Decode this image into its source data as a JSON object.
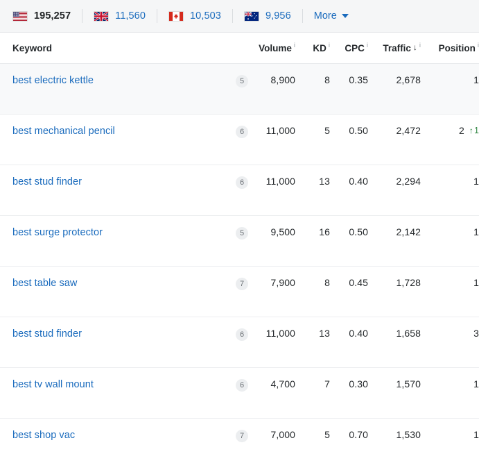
{
  "country_bar": {
    "items": [
      {
        "flag": "us-flag-icon",
        "country": "United States",
        "value": "195,257",
        "active": true
      },
      {
        "flag": "uk-flag-icon",
        "country": "United Kingdom",
        "value": "11,560",
        "active": false
      },
      {
        "flag": "ca-flag-icon",
        "country": "Canada",
        "value": "10,503",
        "active": false
      },
      {
        "flag": "au-flag-icon",
        "country": "Australia",
        "value": "9,956",
        "active": false
      }
    ],
    "more_label": "More",
    "more_caret_icon": "chevron-down-icon",
    "link_color": "#1a6bbd",
    "active_color": "#222527",
    "background": "#f5f6f7"
  },
  "table": {
    "columns": [
      {
        "key": "keyword",
        "label": "Keyword",
        "info": "",
        "align": "left",
        "sorted": false
      },
      {
        "key": "sf",
        "label": "",
        "info": "",
        "align": "right",
        "sorted": false
      },
      {
        "key": "volume",
        "label": "Volume",
        "info": "i",
        "align": "right",
        "sorted": false
      },
      {
        "key": "kd",
        "label": "KD",
        "info": "i",
        "align": "right",
        "sorted": false
      },
      {
        "key": "cpc",
        "label": "CPC",
        "info": "i",
        "align": "right",
        "sorted": false
      },
      {
        "key": "traffic",
        "label": "Traffic",
        "info": "i",
        "align": "right",
        "sorted": true,
        "sort_icon": "sort-descending-arrow",
        "sort_glyph": "↓"
      },
      {
        "key": "position",
        "label": "Position",
        "info": "i",
        "align": "right",
        "sorted": false
      }
    ],
    "rows": [
      {
        "keyword": "best electric kettle",
        "sf": "5",
        "volume": "8,900",
        "kd": "8",
        "cpc": "0.35",
        "traffic": "2,678",
        "position": "1",
        "position_delta": "",
        "position_delta_dir": "",
        "hovered": true
      },
      {
        "keyword": "best mechanical pencil",
        "sf": "6",
        "volume": "11,000",
        "kd": "5",
        "cpc": "0.50",
        "traffic": "2,472",
        "position": "2",
        "position_delta": "1",
        "position_delta_dir": "up",
        "hovered": false
      },
      {
        "keyword": "best stud finder",
        "sf": "6",
        "volume": "11,000",
        "kd": "13",
        "cpc": "0.40",
        "traffic": "2,294",
        "position": "1",
        "position_delta": "",
        "position_delta_dir": "",
        "hovered": false
      },
      {
        "keyword": "best surge protector",
        "sf": "5",
        "volume": "9,500",
        "kd": "16",
        "cpc": "0.50",
        "traffic": "2,142",
        "position": "1",
        "position_delta": "",
        "position_delta_dir": "",
        "hovered": false
      },
      {
        "keyword": "best table saw",
        "sf": "7",
        "volume": "7,900",
        "kd": "8",
        "cpc": "0.45",
        "traffic": "1,728",
        "position": "1",
        "position_delta": "",
        "position_delta_dir": "",
        "hovered": false
      },
      {
        "keyword": "best stud finder",
        "sf": "6",
        "volume": "11,000",
        "kd": "13",
        "cpc": "0.40",
        "traffic": "1,658",
        "position": "3",
        "position_delta": "",
        "position_delta_dir": "",
        "hovered": false
      },
      {
        "keyword": "best tv wall mount",
        "sf": "6",
        "volume": "4,700",
        "kd": "7",
        "cpc": "0.30",
        "traffic": "1,570",
        "position": "1",
        "position_delta": "",
        "position_delta_dir": "",
        "hovered": false
      },
      {
        "keyword": "best shop vac",
        "sf": "7",
        "volume": "7,000",
        "kd": "5",
        "cpc": "0.70",
        "traffic": "1,530",
        "position": "1",
        "position_delta": "",
        "position_delta_dir": "",
        "hovered": false
      }
    ],
    "delta_up_color": "#2e8540",
    "delta_up_glyph": "↑",
    "delta_down_glyph": "↓",
    "keyword_link_color": "#1a6bbd",
    "badge_background": "#eceef0",
    "badge_text_color": "#6b7075"
  }
}
